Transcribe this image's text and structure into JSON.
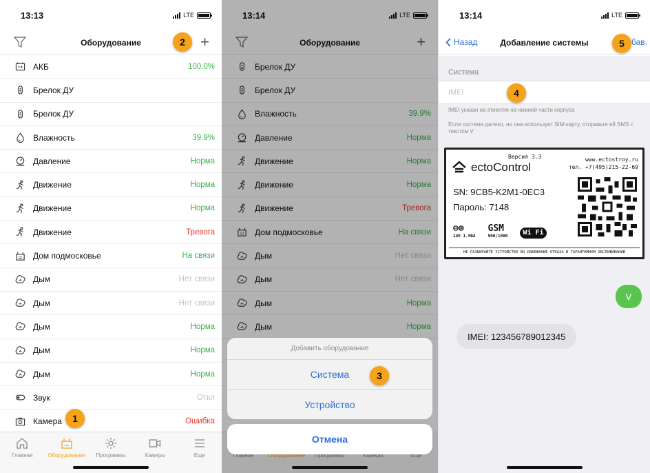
{
  "colors": {
    "accent": "#f7a21b",
    "ok": "#3eb34d",
    "alarm": "#e23a2a",
    "link": "#2f6fd6",
    "disabled": "#c4c4c4"
  },
  "screen1": {
    "time": "13:13",
    "network": "LTE",
    "title": "Оборудование",
    "filter_icon": "filter-icon",
    "add_icon": "plus-icon",
    "badge_add": "2",
    "badge_camera": "1",
    "rows": [
      {
        "icon": "battery-icon",
        "name": "АКБ",
        "value": "100.0%",
        "status": "green"
      },
      {
        "icon": "keyfob-icon",
        "name": "Брелок ДУ",
        "value": "",
        "status": ""
      },
      {
        "icon": "keyfob-icon",
        "name": "Брелок ДУ",
        "value": "",
        "status": ""
      },
      {
        "icon": "humidity-icon",
        "name": "Влажность",
        "value": "39.9%",
        "status": "green"
      },
      {
        "icon": "pressure-icon",
        "name": "Давление",
        "value": "Норма",
        "status": "green"
      },
      {
        "icon": "motion-icon",
        "name": "Движение",
        "value": "Норма",
        "status": "green"
      },
      {
        "icon": "motion-icon",
        "name": "Движение",
        "value": "Норма",
        "status": "green"
      },
      {
        "icon": "motion-icon",
        "name": "Движение",
        "value": "Тревога",
        "status": "red"
      },
      {
        "icon": "house-icon",
        "name": "Дом подмосковье",
        "value": "На связи",
        "status": "green"
      },
      {
        "icon": "smoke-icon",
        "name": "Дым",
        "value": "Нет связи",
        "status": "gray"
      },
      {
        "icon": "smoke-icon",
        "name": "Дым",
        "value": "Нет связи",
        "status": "gray"
      },
      {
        "icon": "smoke-icon",
        "name": "Дым",
        "value": "Норма",
        "status": "green"
      },
      {
        "icon": "smoke-icon",
        "name": "Дым",
        "value": "Норма",
        "status": "green"
      },
      {
        "icon": "smoke-icon",
        "name": "Дым",
        "value": "Норма",
        "status": "green"
      },
      {
        "icon": "sound-icon",
        "name": "Звук",
        "value": "Откл",
        "status": "gray"
      },
      {
        "icon": "camera-icon",
        "name": "Камера",
        "value": "Ошибка",
        "status": "red"
      }
    ],
    "tabs": [
      {
        "icon": "home-icon",
        "label": "Главная",
        "active": false
      },
      {
        "icon": "equipment-icon",
        "label": "Оборудование",
        "active": true
      },
      {
        "icon": "programs-icon",
        "label": "Программы",
        "active": false
      },
      {
        "icon": "cameras-icon",
        "label": "Камеры",
        "active": false
      },
      {
        "icon": "menu-icon",
        "label": "Еще",
        "active": false
      }
    ]
  },
  "screen2": {
    "time": "13:14",
    "network": "LTE",
    "title": "Оборудование",
    "badge_system": "3",
    "rows": [
      {
        "icon": "keyfob-icon",
        "name": "Брелок ДУ",
        "value": "",
        "status": ""
      },
      {
        "icon": "keyfob-icon",
        "name": "Брелок ДУ",
        "value": "",
        "status": ""
      },
      {
        "icon": "humidity-icon",
        "name": "Влажность",
        "value": "39.9%",
        "status": "green"
      },
      {
        "icon": "pressure-icon",
        "name": "Давление",
        "value": "Норма",
        "status": "green"
      },
      {
        "icon": "motion-icon",
        "name": "Движение",
        "value": "Норма",
        "status": "green"
      },
      {
        "icon": "motion-icon",
        "name": "Движение",
        "value": "Норма",
        "status": "green"
      },
      {
        "icon": "motion-icon",
        "name": "Движение",
        "value": "Тревога",
        "status": "red"
      },
      {
        "icon": "house-icon",
        "name": "Дом подмосковье",
        "value": "На связи",
        "status": "green"
      },
      {
        "icon": "smoke-icon",
        "name": "Дым",
        "value": "Нет связи",
        "status": "gray"
      },
      {
        "icon": "smoke-icon",
        "name": "Дым",
        "value": "Нет связи",
        "status": "gray"
      },
      {
        "icon": "smoke-icon",
        "name": "Дым",
        "value": "Норма",
        "status": "green"
      },
      {
        "icon": "smoke-icon",
        "name": "Дым",
        "value": "Норма",
        "status": "green"
      }
    ],
    "sheet": {
      "title": "Добавить оборудование",
      "system": "Система",
      "device": "Устройство",
      "cancel": "Отмена"
    },
    "tabs": [
      {
        "icon": "home-icon",
        "label": "Главная",
        "active": false
      },
      {
        "icon": "equipment-icon",
        "label": "Оборудование",
        "active": true
      },
      {
        "icon": "programs-icon",
        "label": "Программы",
        "active": false
      },
      {
        "icon": "cameras-icon",
        "label": "Камеры",
        "active": false
      },
      {
        "icon": "menu-icon",
        "label": "Еще",
        "active": false
      }
    ]
  },
  "screen3": {
    "time": "13:14",
    "network": "LTE",
    "back": "Назад",
    "title": "Добавление системы",
    "add": "бав.",
    "badge_imei": "4",
    "badge_add": "5",
    "section": "Система",
    "imei_placeholder": "IMEI",
    "hint1": "IMEI указан на этикетке на нижней части корпуса",
    "hint2": "Если система далеко, но она использует SIM-карту, отправьте ей SMS с текстом V",
    "label": {
      "version": "Версия 3.3",
      "site": "www.ectostroy.ru",
      "phone": "тел. +7(495)215-22-69",
      "brand": "ectoControl",
      "sn": "SN: 9CB5-K2M1-0EC3",
      "password": "Пароль: 7148",
      "freq1_glyph": "⊖⊕",
      "freq1": "14Е 1.5ВА",
      "gsm_glyph": "GSM",
      "gsm": "900/1800",
      "wifi": "Wi Fi",
      "warning": "НЕ РАЗБИРАЙТЕ УСТРОЙСТВО ВО ИЗБЕЖАНИЕ ОТКАЗА В ГАРАНТИЙНОМ ОБСЛУЖИВАНИИ"
    },
    "msg_out": "V",
    "msg_in": "IMEI: 123456789012345"
  }
}
